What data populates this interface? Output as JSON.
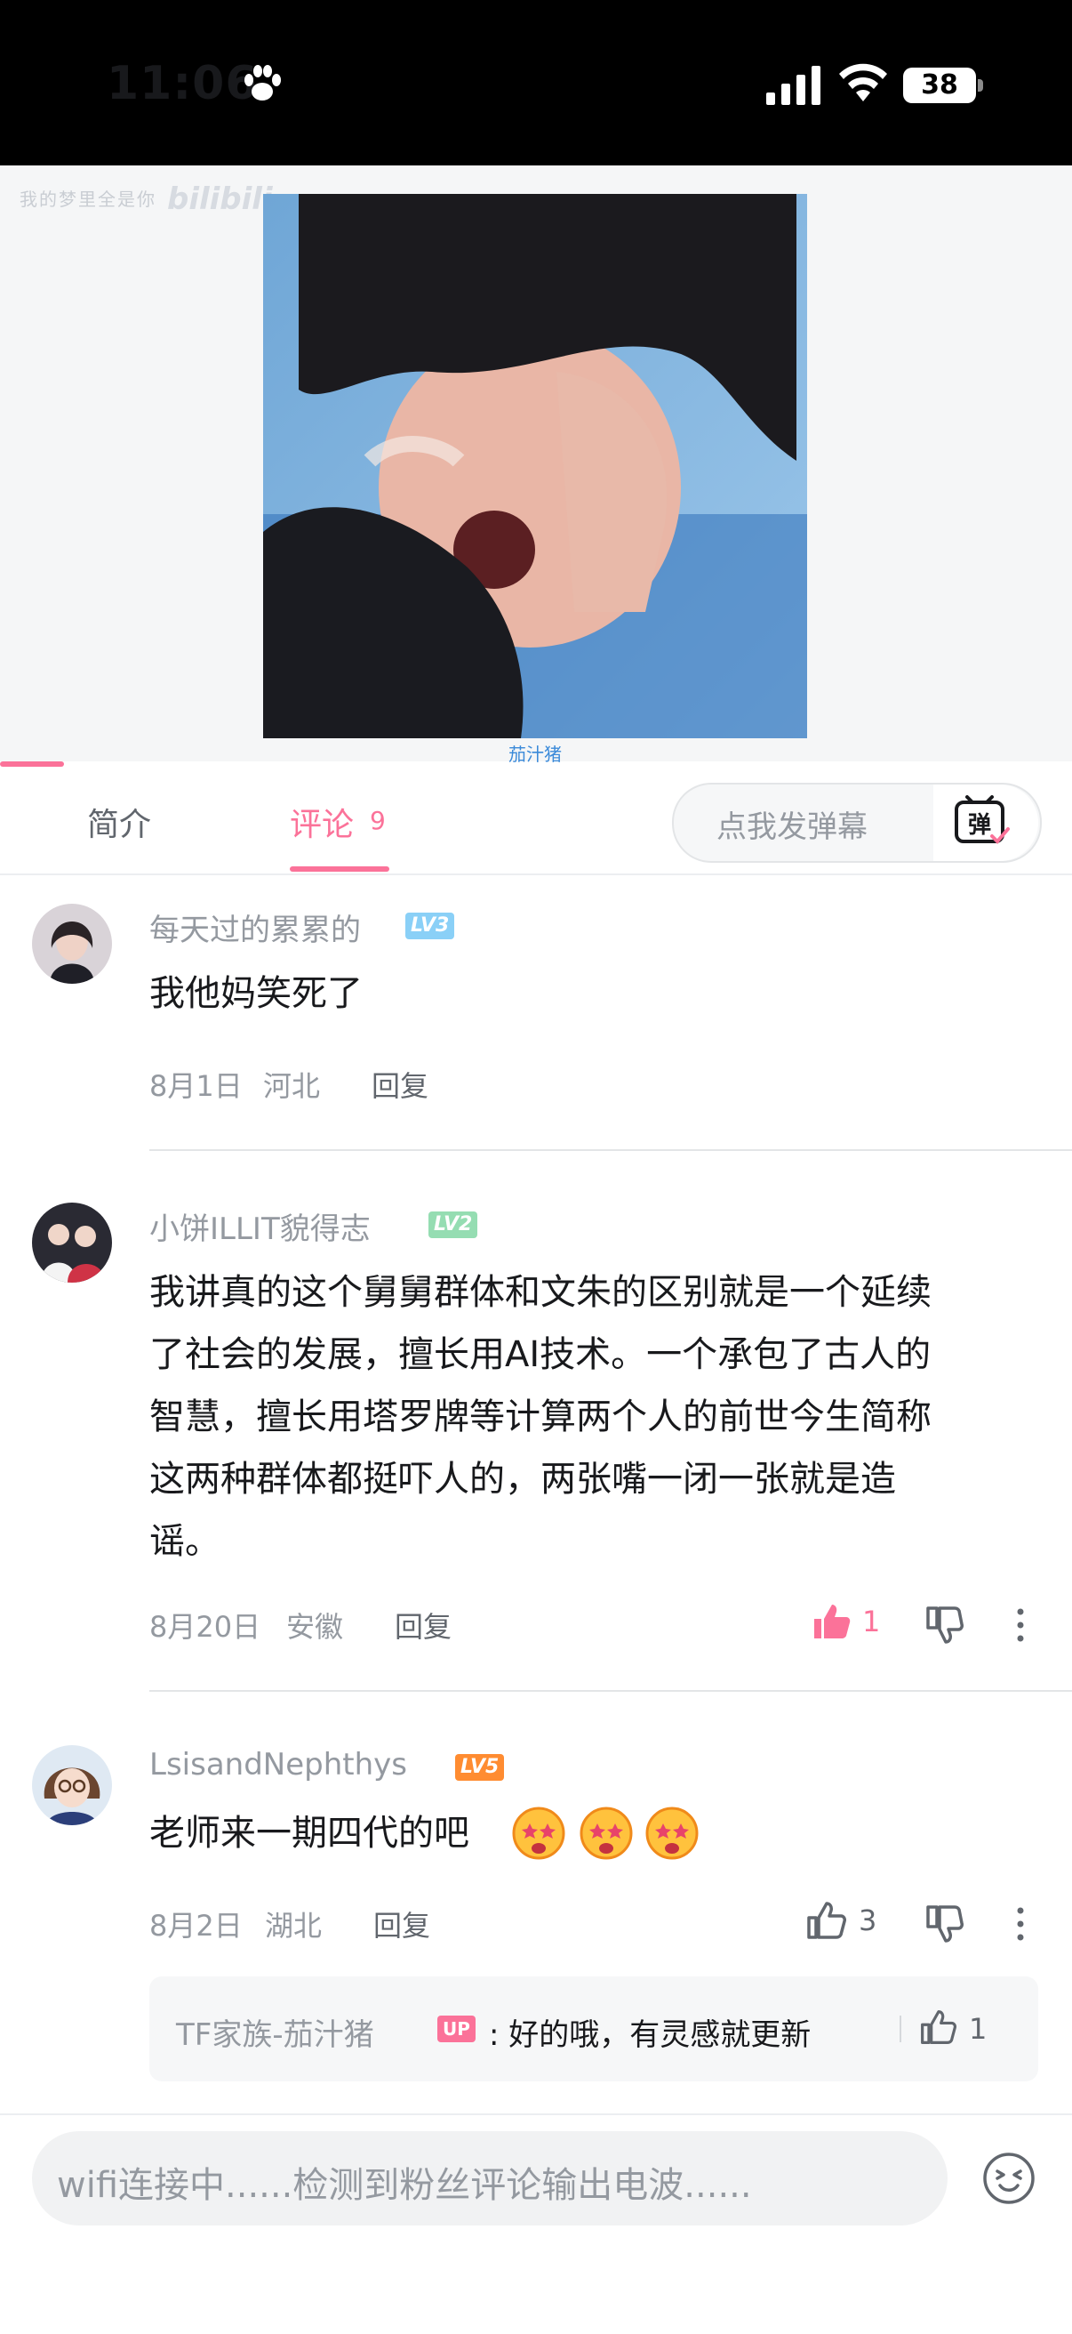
{
  "status_bar": {
    "time": "11:06",
    "battery": "38"
  },
  "video": {
    "watermark": "我的梦里全是你",
    "logo": "bilibili",
    "credit": "茄汁猪"
  },
  "tabs": {
    "intro": "简介",
    "comments": "评论",
    "comments_count": "9",
    "danmaku_placeholder": "点我发弹幕",
    "danmaku_icon_label": "弹"
  },
  "comments": [
    {
      "username": "每天过的累累的",
      "level": "LV3",
      "text": "我他妈笑死了",
      "date": "8月1日",
      "location": "河北",
      "reply_label": "回复"
    },
    {
      "username": "小饼ILLIT貌得志",
      "level": "LV2",
      "text_lines": [
        "我讲真的这个舅舅群体和文朱的区别就是一个延续",
        "了社会的发展，擅长用AI技术。一个承包了古人的",
        "智慧，擅长用塔罗牌等计算两个人的前世今生简称",
        "这两种群体都挺吓人的，两张嘴一闭一张就是造",
        "谣。"
      ],
      "date": "8月20日",
      "location": "安徽",
      "reply_label": "回复",
      "likes": "1"
    },
    {
      "username": "LsisandNephthys",
      "level": "LV5",
      "text": "老师来一期四代的吧",
      "date": "8月2日",
      "location": "湖北",
      "reply_label": "回复",
      "likes": "3",
      "sub_reply": {
        "author": "TF家族-茄汁猪",
        "badge": "UP",
        "text": ": 好的哦，有灵感就更新",
        "likes": "1"
      }
    }
  ],
  "input": {
    "placeholder": "wifi连接中......检测到粉丝评论输出电波......"
  },
  "colors": {
    "accent": "#fb7299",
    "lv3": "#8ad0f7",
    "lv2": "#95ddb2",
    "lv5": "#ff8c31",
    "link": "#3b8ad9"
  }
}
